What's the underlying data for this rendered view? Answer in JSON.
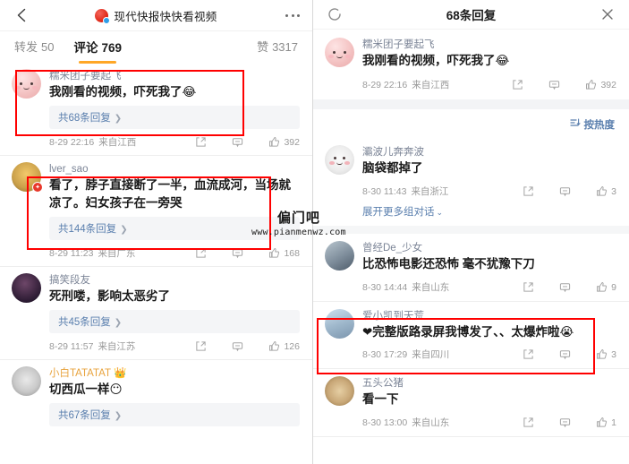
{
  "watermark": {
    "line1": "偏门吧",
    "line2": "www.pianmenwz.com"
  },
  "left_panel": {
    "header": {
      "brand_title": "现代快报快快看视频",
      "back_icon": "back-arrow-icon",
      "more_icon": "more-dots-icon"
    },
    "tabs": [
      {
        "label": "转发",
        "count": "50",
        "active": false
      },
      {
        "label": "评论",
        "count": "769",
        "active": true
      },
      {
        "label": "赞",
        "count": "3317",
        "active": false
      }
    ],
    "comments": [
      {
        "name": "糯米团子要起飞",
        "text": "我刚看的视频，吓死我了😂",
        "reply_label": "共68条回复",
        "time": "8-29 22:16",
        "source": "来自江西",
        "likes": "392",
        "highlighted": true,
        "name_color": "gray"
      },
      {
        "name": "lver_sao",
        "text": "看了，脖子直接断了一半，血流成河，当场就凉了。妇女孩子在一旁哭",
        "reply_label": "共144条回复",
        "time": "8-29 11:23",
        "source": "来自广东",
        "likes": "168",
        "highlighted": true,
        "name_color": "gray"
      },
      {
        "name": "搞笑段友",
        "text": "死刑喽，影响太恶劣了",
        "reply_label": "共45条回复",
        "time": "8-29 11:57",
        "source": "来自江苏",
        "likes": "126",
        "highlighted": false,
        "name_color": "gray"
      },
      {
        "name": "小白TATATAT 👑",
        "text": "切西瓜一样😶",
        "reply_label": "共67条回复",
        "time": "",
        "source": "",
        "likes": "",
        "highlighted": false,
        "name_color": "orange"
      }
    ]
  },
  "right_panel": {
    "header": {
      "title": "68条回复",
      "refresh_icon": "refresh-icon",
      "close_icon": "close-icon"
    },
    "sort": {
      "label": "按热度",
      "icon": "sort-icon"
    },
    "expand_label": "展开更多组对话",
    "comments": [
      {
        "name": "糯米团子要起飞",
        "text": "我刚看的视频，吓死我了😂",
        "time": "8-29 22:16",
        "source": "来自江西",
        "likes": "392",
        "highlighted": false
      },
      {
        "name": "灞波儿奔奔波",
        "text": "脑袋都掉了",
        "time": "8-30 11:43",
        "source": "来自浙江",
        "likes": "3",
        "highlighted": false
      },
      {
        "name": "曾经De_少女",
        "text": "比恐怖电影还恐怖 毫不犹豫下刀",
        "time": "8-30 14:44",
        "source": "来自山东",
        "likes": "9",
        "highlighted": false
      },
      {
        "name": "爱小凯到天荒",
        "text": "❤完整版路录屏我博发了、、太爆炸啦😭",
        "time": "8-30 17:29",
        "source": "来自四川",
        "likes": "3",
        "highlighted": true
      },
      {
        "name": "五头公猪",
        "text": "看一下",
        "time": "8-30 13:00",
        "source": "来自山东",
        "likes": "1",
        "highlighted": false
      }
    ]
  },
  "icons": {
    "share": "share-icon",
    "comment": "comment-icon",
    "like": "thumbs-up-icon"
  },
  "colors": {
    "accent": "#ffa726",
    "link": "#5a7fae",
    "highlight": "#ff0000",
    "name_orange": "#e8a33d"
  }
}
